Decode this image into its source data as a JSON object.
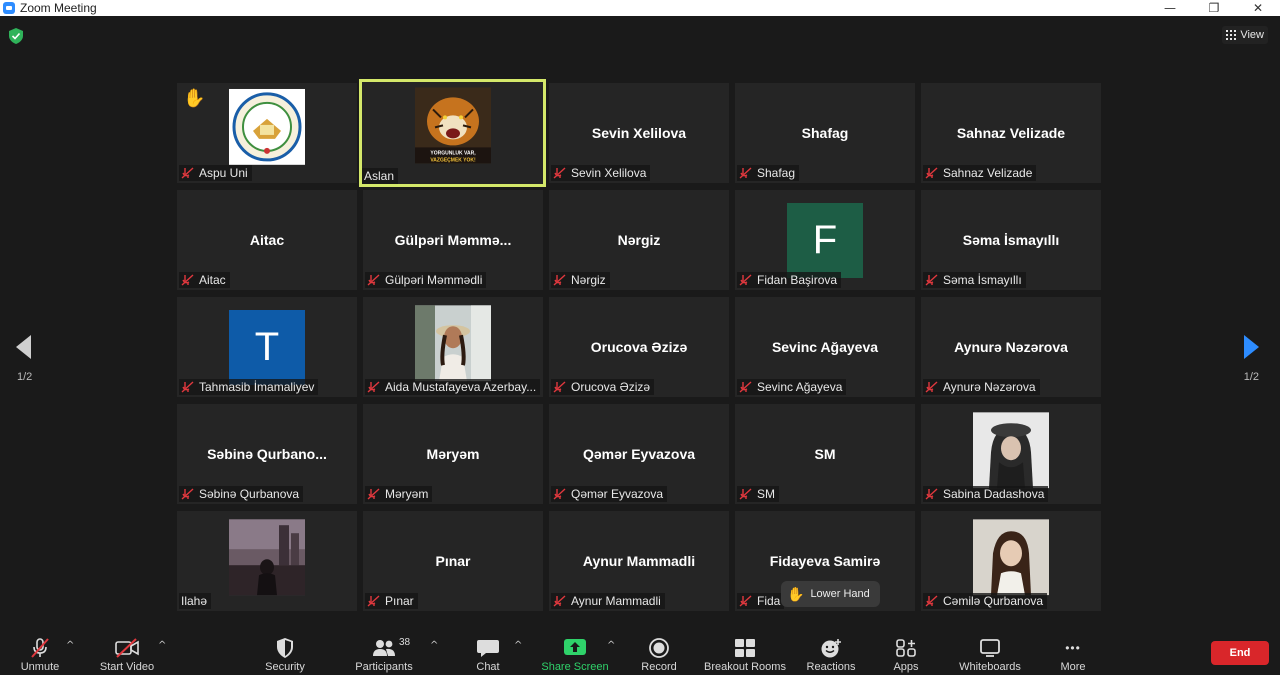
{
  "window": {
    "title": "Zoom Meeting",
    "minimize": "—",
    "restore": "❐",
    "close": "✕"
  },
  "header": {
    "view_label": "View"
  },
  "pagination": {
    "left": "1/2",
    "right": "1/2"
  },
  "tiles": [
    {
      "id": "aspu-uni",
      "center": "",
      "label": "Aspu Uni",
      "muted": true,
      "hand": "✋"
    },
    {
      "id": "aslan",
      "center": "",
      "label": "Aslan",
      "muted": false,
      "active": true,
      "pic_text_1": "YORGUNLUK VAR,",
      "pic_text_2": "VAZGEÇMEK YOK!"
    },
    {
      "id": "sevin-xelilova",
      "center": "Sevin Xelilova",
      "label": "Sevin Xelilova",
      "muted": true
    },
    {
      "id": "shafag",
      "center": "Shafag",
      "label": "Shafag",
      "muted": true
    },
    {
      "id": "sahnaz-velizade",
      "center": "Sahnaz Velizade",
      "label": "Sahnaz Velizade",
      "muted": true
    },
    {
      "id": "aitac",
      "center": "Aitac",
      "label": "Aitac",
      "muted": true
    },
    {
      "id": "gulperi",
      "center": "Gülpəri  Məmmə...",
      "label": "Gülpəri Məmmədli",
      "muted": true
    },
    {
      "id": "nergiz",
      "center": "Nərgiz",
      "label": "Nərgiz",
      "muted": true
    },
    {
      "id": "fidan",
      "center": "",
      "label": "Fidan Başirova",
      "muted": true,
      "avatar": "F"
    },
    {
      "id": "sema",
      "center": "Səma İsmayıllı",
      "label": "Səma İsmayıllı",
      "muted": true
    },
    {
      "id": "tahmasib",
      "center": "",
      "label": "Tahmasib İmamaliyev",
      "muted": true,
      "avatar": "T"
    },
    {
      "id": "aida",
      "center": "",
      "label": "Aida Mustafayeva Azerbay...",
      "muted": true
    },
    {
      "id": "orucova",
      "center": "Orucova Əzizə",
      "label": "Orucova Əzizə",
      "muted": true
    },
    {
      "id": "sevinc",
      "center": "Sevinc Ağayeva",
      "label": "Sevinc Ağayeva",
      "muted": true
    },
    {
      "id": "aynure",
      "center": "Aynurə Nəzərova",
      "label": "Aynurə Nəzərova",
      "muted": true
    },
    {
      "id": "sebine",
      "center": "Səbinə  Qurbano...",
      "label": "Səbinə Qurbanova",
      "muted": true
    },
    {
      "id": "meryem",
      "center": "Məryəm",
      "label": "Məryəm",
      "muted": true
    },
    {
      "id": "qemer",
      "center": "Qəmər Eyvazova",
      "label": "Qəmər Eyvazova",
      "muted": true
    },
    {
      "id": "sm",
      "center": "SM",
      "label": "SM",
      "muted": true
    },
    {
      "id": "sabina",
      "center": "",
      "label": "Sabina Dadashova",
      "muted": true
    },
    {
      "id": "ilahe",
      "center": "",
      "label": "Ilahə",
      "muted": false
    },
    {
      "id": "pinar",
      "center": "Pınar",
      "label": "Pınar",
      "muted": true
    },
    {
      "id": "aynur-m",
      "center": "Aynur Mammadli",
      "label": "Aynur Mammadli",
      "muted": true
    },
    {
      "id": "fidayeva",
      "center": "Fidayeva Samirə",
      "label": "Fida",
      "muted": true
    },
    {
      "id": "camile",
      "center": "",
      "label": "Cəmilə Qurbanova",
      "muted": true
    }
  ],
  "lower_hand": {
    "icon": "✋",
    "label": "Lower Hand"
  },
  "toolbar": {
    "unmute": "Unmute",
    "start_video": "Start Video",
    "security": "Security",
    "participants": "Participants",
    "participants_count": "38",
    "chat": "Chat",
    "share_screen": "Share Screen",
    "record": "Record",
    "breakout_rooms": "Breakout Rooms",
    "reactions": "Reactions",
    "apps": "Apps",
    "whiteboards": "Whiteboards",
    "more": "More",
    "end": "End",
    "caret": "^",
    "more_dots": "•••"
  },
  "colors": {
    "background": "#1a1a1a",
    "tile": "#252525",
    "active_border": "#d4e86a",
    "share_green": "#2fd26a",
    "end_red": "#d9262a",
    "mute_red": "#e0383e",
    "nav_blue": "#2d8cff"
  }
}
